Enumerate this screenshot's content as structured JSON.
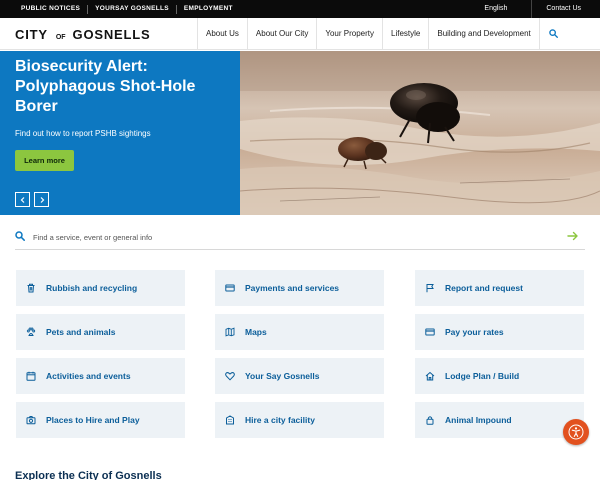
{
  "topbar": {
    "left_links": [
      {
        "label": "PUBLIC NOTICES"
      },
      {
        "label": "YOURSAY GOSNELLS"
      },
      {
        "label": "EMPLOYMENT"
      }
    ],
    "language": "English",
    "contact": "Contact Us"
  },
  "header": {
    "logo": {
      "word1": "CITY",
      "word2": "OF",
      "word3": "GOSNELLS"
    },
    "nav": [
      {
        "label": "About Us"
      },
      {
        "label": "About Our City"
      },
      {
        "label": "Your Property"
      },
      {
        "label": "Lifestyle"
      },
      {
        "label": "Building and Development"
      }
    ],
    "search_icon": "search-icon"
  },
  "hero": {
    "title": "Biosecurity Alert: Polyphagous Shot-Hole Borer",
    "subtitle": "Find out how to report PSHB sightings",
    "button": "Learn more",
    "image": "shot-hole-borer-beetle-photo"
  },
  "search": {
    "placeholder": "Find a service, event or general info",
    "value": ""
  },
  "colors": {
    "hero_blue": "#0d78c1",
    "accent_green": "#8cc63f",
    "link_blue": "#0b5e9a",
    "tile_bg": "#edf2f6",
    "a11y_orange": "#e2511f"
  },
  "tiles": [
    {
      "label": "Rubbish and recycling",
      "icon": "bin-icon"
    },
    {
      "label": "Payments and services",
      "icon": "card-icon"
    },
    {
      "label": "Report and request",
      "icon": "flag-icon"
    },
    {
      "label": "Pets and animals",
      "icon": "paw-icon"
    },
    {
      "label": "Maps",
      "icon": "map-icon"
    },
    {
      "label": "Pay your rates",
      "icon": "card-icon"
    },
    {
      "label": "Activities and events",
      "icon": "calendar-icon"
    },
    {
      "label": "Your Say Gosnells",
      "icon": "heart-icon"
    },
    {
      "label": "Lodge Plan / Build",
      "icon": "house-icon"
    },
    {
      "label": "Places to Hire and Play",
      "icon": "camera-icon"
    },
    {
      "label": "Hire a city facility",
      "icon": "building-icon"
    },
    {
      "label": "Animal Impound",
      "icon": "lock-icon"
    }
  ],
  "explore_heading": "Explore the City of Gosnells",
  "accessibility": {
    "icon": "accessibility-icon"
  }
}
